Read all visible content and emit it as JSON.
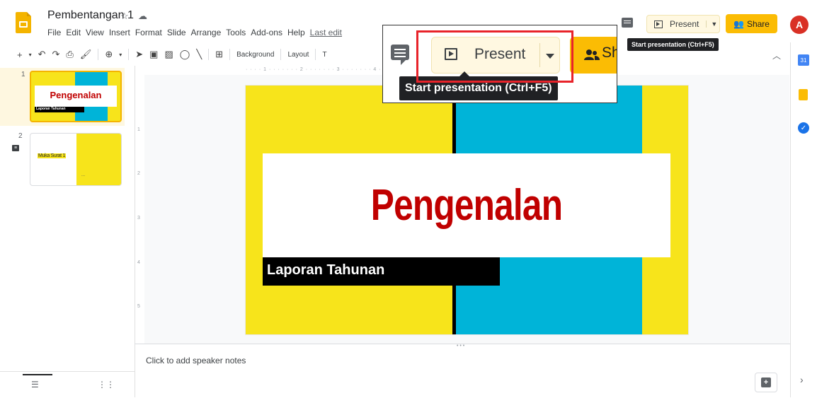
{
  "header": {
    "doc_title": "Pembentangan 1",
    "star_icon": "star-icon",
    "cloud_icon": "cloud-status-icon",
    "menu": [
      "File",
      "Edit",
      "View",
      "Insert",
      "Format",
      "Slide",
      "Arrange",
      "Tools",
      "Add-ons",
      "Help"
    ],
    "last_edit": "Last edit",
    "present_label": "Present",
    "share_label": "Share",
    "avatar_letter": "A",
    "tooltip": "Start presentation (Ctrl+F5)"
  },
  "toolbar": {
    "background_label": "Background",
    "layout_label": "Layout",
    "theme_label": "T"
  },
  "ruler": {
    "h_text": "· · · · 1 · · · · · · · 2 · · · · · · · 3 · · · · · · · 4 · · · · · · · 5 · · · · · · · 6 · · · · · · · 7 · · · · · · · 8 · · · · · · · 9 · · · · · ·",
    "v_marks": [
      "1",
      "2",
      "3",
      "4",
      "5"
    ]
  },
  "filmstrip": {
    "slides": [
      {
        "num": "1",
        "title": "Pengenalan",
        "subtitle": "Laporan Tahunan"
      },
      {
        "num": "2",
        "title": "Muka Surat 1",
        "footer": "..."
      }
    ],
    "slide2_notes_icon": "speaker-notes-icon"
  },
  "slide": {
    "title": "Pengenalan",
    "subtitle": "Laporan Tahunan",
    "colors": {
      "yellow": "#f7e41b",
      "cyan": "#00b4d8",
      "red": "#c00000",
      "black": "#000000"
    }
  },
  "notes": {
    "placeholder": "Click to add speaker notes"
  },
  "zoom_popup": {
    "present_label": "Present",
    "share_label_partial": "Sh",
    "tooltip": "Start presentation (Ctrl+F5)",
    "highlight_color": "#e8232a"
  },
  "side_panel": {
    "calendar_label": "31",
    "tasks_label": "✓"
  }
}
